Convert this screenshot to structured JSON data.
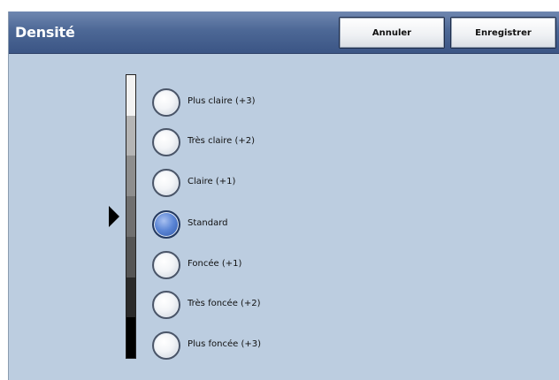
{
  "window": {
    "title": "Densité"
  },
  "toolbar": {
    "cancel_label": "Annuler",
    "save_label": "Enregistrer"
  },
  "density": {
    "selected": "Standard",
    "options": [
      {
        "label": "Plus claire (+3)",
        "selected": false
      },
      {
        "label": "Très claire (+2)",
        "selected": false
      },
      {
        "label": "Claire (+1)",
        "selected": false
      },
      {
        "label": "Standard",
        "selected": true
      },
      {
        "label": "Foncée (+1)",
        "selected": false
      },
      {
        "label": "Très foncée (+2)",
        "selected": false
      },
      {
        "label": "Plus foncée (+3)",
        "selected": false
      }
    ],
    "scale_colors": [
      "#f2f2f2",
      "#b5b5b5",
      "#8e8e8e",
      "#707070",
      "#555555",
      "#2a2a2a",
      "#000000"
    ],
    "accent_color": "#4d6896",
    "selected_radio_color": "#5c86d6"
  }
}
